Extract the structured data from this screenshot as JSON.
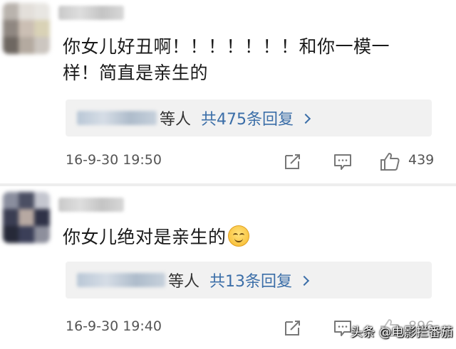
{
  "comments": [
    {
      "text_line1": "你女儿好丑啊！！！！！！！和你一模一",
      "text_line2": "样！简直是亲生的",
      "reply_suffix": "等人",
      "reply_count": "共475条回复",
      "timestamp": "16-9-30 19:50",
      "likes": "439"
    },
    {
      "text": "你女儿绝对是亲生的",
      "emoji": "smiling-face",
      "reply_suffix": "等人",
      "reply_count": "共13条回复",
      "timestamp": "16-9-30 19:40",
      "likes": "896"
    }
  ],
  "watermark": "头条 @电影拦番茄",
  "colors": {
    "link": "#3b6ea8",
    "reply_bg": "#f1f1f1",
    "meta_text": "#555555"
  }
}
